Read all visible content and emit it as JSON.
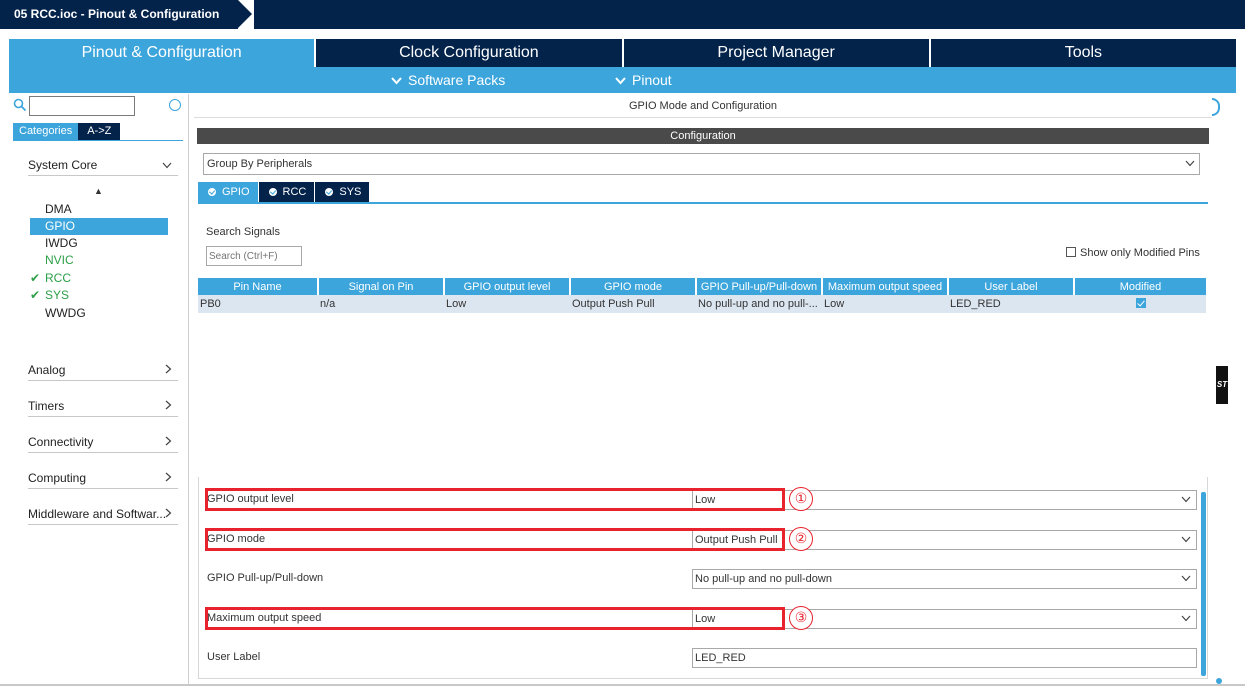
{
  "window": {
    "title": "05 RCC.ioc - Pinout & Configuration"
  },
  "main_tabs": [
    {
      "label": "Pinout & Configuration",
      "active": true
    },
    {
      "label": "Clock Configuration",
      "active": false
    },
    {
      "label": "Project Manager",
      "active": false
    },
    {
      "label": "Tools",
      "active": false
    }
  ],
  "sub_bar": {
    "software_packs": "Software Packs",
    "pinout": "Pinout"
  },
  "left_panel": {
    "search_value": "",
    "category_buttons": {
      "categories": "Categories",
      "az": "A->Z"
    },
    "system_core": {
      "label": "System Core",
      "items": [
        {
          "label": "DMA",
          "state": "normal"
        },
        {
          "label": "GPIO",
          "state": "selected"
        },
        {
          "label": "IWDG",
          "state": "normal"
        },
        {
          "label": "NVIC",
          "state": "green"
        },
        {
          "label": "RCC",
          "state": "checked"
        },
        {
          "label": "SYS",
          "state": "checked"
        },
        {
          "label": "WWDG",
          "state": "normal"
        }
      ]
    },
    "categories": [
      {
        "label": "Analog"
      },
      {
        "label": "Timers"
      },
      {
        "label": "Connectivity"
      },
      {
        "label": "Computing"
      },
      {
        "label": "Middleware and Softwar..."
      }
    ]
  },
  "right_panel": {
    "header": "GPIO Mode and Configuration",
    "config_bar": "Configuration",
    "group_by": "Group By Peripherals",
    "tabs": [
      {
        "label": "GPIO",
        "active": true
      },
      {
        "label": "RCC",
        "active": false
      },
      {
        "label": "SYS",
        "active": false
      }
    ],
    "search_signals_label": "Search Signals",
    "search_placeholder": "Search (Ctrl+F)",
    "show_only_modified": "Show only Modified Pins",
    "table": {
      "columns": [
        "Pin Name",
        "Signal on Pin",
        "GPIO output level",
        "GPIO mode",
        "GPIO Pull-up/Pull-down",
        "Maximum output speed",
        "User Label",
        "Modified"
      ],
      "rows": [
        {
          "pin": "PB0",
          "signal": "n/a",
          "level": "Low",
          "mode": "Output Push Pull",
          "pull": "No pull-up and no pull-...",
          "speed": "Low",
          "label": "LED_RED",
          "modified": true
        }
      ]
    },
    "config_fields": [
      {
        "label": "GPIO output level",
        "value": "Low",
        "highlight": true,
        "marker": "①"
      },
      {
        "label": "GPIO mode",
        "value": "Output Push Pull",
        "highlight": true,
        "marker": "②"
      },
      {
        "label": "GPIO Pull-up/Pull-down",
        "value": "No pull-up and no pull-down",
        "highlight": false,
        "marker": ""
      },
      {
        "label": "Maximum output speed",
        "value": "Low",
        "highlight": true,
        "marker": "③"
      },
      {
        "label": "User Label",
        "value": "LED_RED",
        "highlight": false,
        "marker": ""
      }
    ]
  },
  "colors": {
    "navy": "#03234b",
    "accent_blue": "#3ca5dc",
    "highlight_red": "#e8232e",
    "ok_green": "#2d9f48"
  },
  "gutter": {
    "logo": "ST"
  }
}
